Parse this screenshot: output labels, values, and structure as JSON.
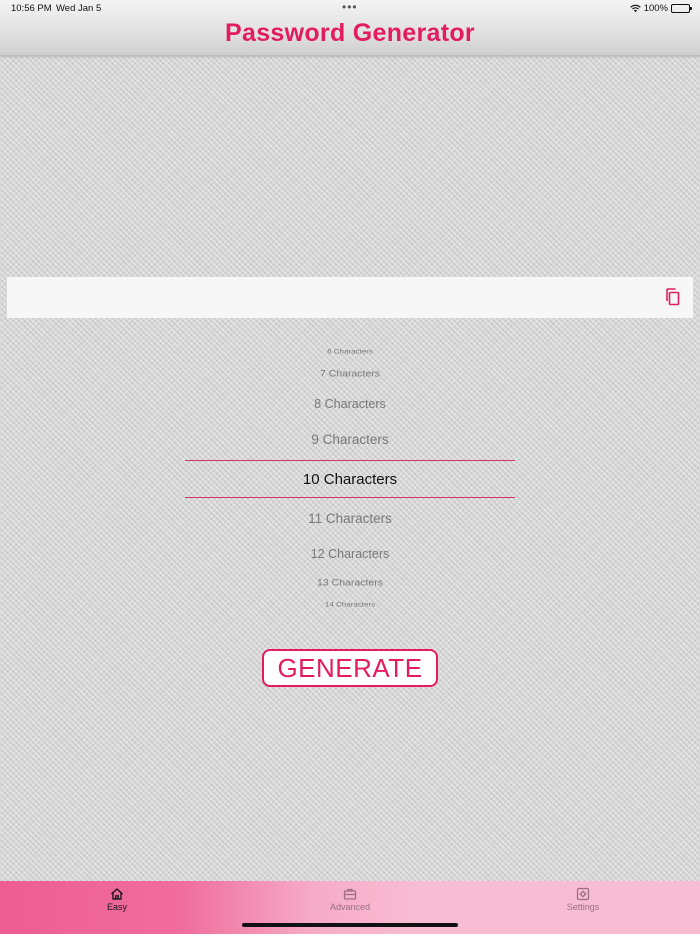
{
  "status_bar": {
    "time": "10:56 PM",
    "date": "Wed Jan 5",
    "dots": "•••",
    "battery": "100%"
  },
  "header": {
    "title": "Password Generator"
  },
  "password": {
    "value": "",
    "copy_icon": "copy-icon"
  },
  "picker": {
    "items": [
      "6 Characters",
      "7 Characters",
      "8 Characters",
      "9 Characters",
      "10 Characters",
      "11 Characters",
      "12 Characters",
      "13 Characters",
      "14 Characters"
    ],
    "selected": "10 Characters"
  },
  "generate": {
    "label": "GENERATE"
  },
  "colors": {
    "accent": "#e31c5f",
    "tab_bar_active": "#ee5d92",
    "tab_bar": "#f8bdd2"
  },
  "tabs": [
    {
      "label": "Easy",
      "icon": "home-icon",
      "active": true
    },
    {
      "label": "Advanced",
      "icon": "briefcase-icon",
      "active": false
    },
    {
      "label": "Settings",
      "icon": "gear-icon",
      "active": false
    }
  ]
}
